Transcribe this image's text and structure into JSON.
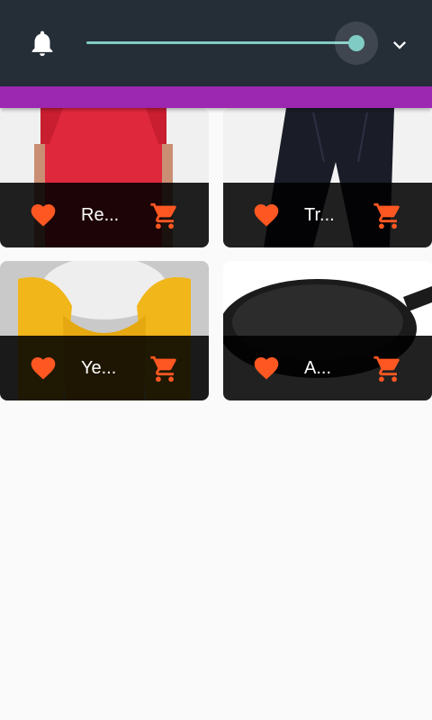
{
  "app_bar": {
    "background": "#252d37",
    "bell_icon": "notifications-bell-icon",
    "slider_value": 1.0,
    "slider_color": "#80cbc4",
    "chevron_icon": "chevron-down-icon"
  },
  "accent_bar_color": "#9c27b0",
  "products": [
    {
      "title": "Re...",
      "image": "red-t-shirt",
      "favorite_icon": "heart-icon",
      "cart_icon": "shopping-cart-icon"
    },
    {
      "title": "Tr...",
      "image": "black-trousers",
      "favorite_icon": "heart-icon",
      "cart_icon": "shopping-cart-icon"
    },
    {
      "title": "Ye...",
      "image": "yellow-scarf",
      "favorite_icon": "heart-icon",
      "cart_icon": "shopping-cart-icon"
    },
    {
      "title": "A...",
      "image": "cast-iron-pan",
      "favorite_icon": "heart-icon",
      "cart_icon": "shopping-cart-icon"
    }
  ],
  "icon_color": "#ff5722"
}
